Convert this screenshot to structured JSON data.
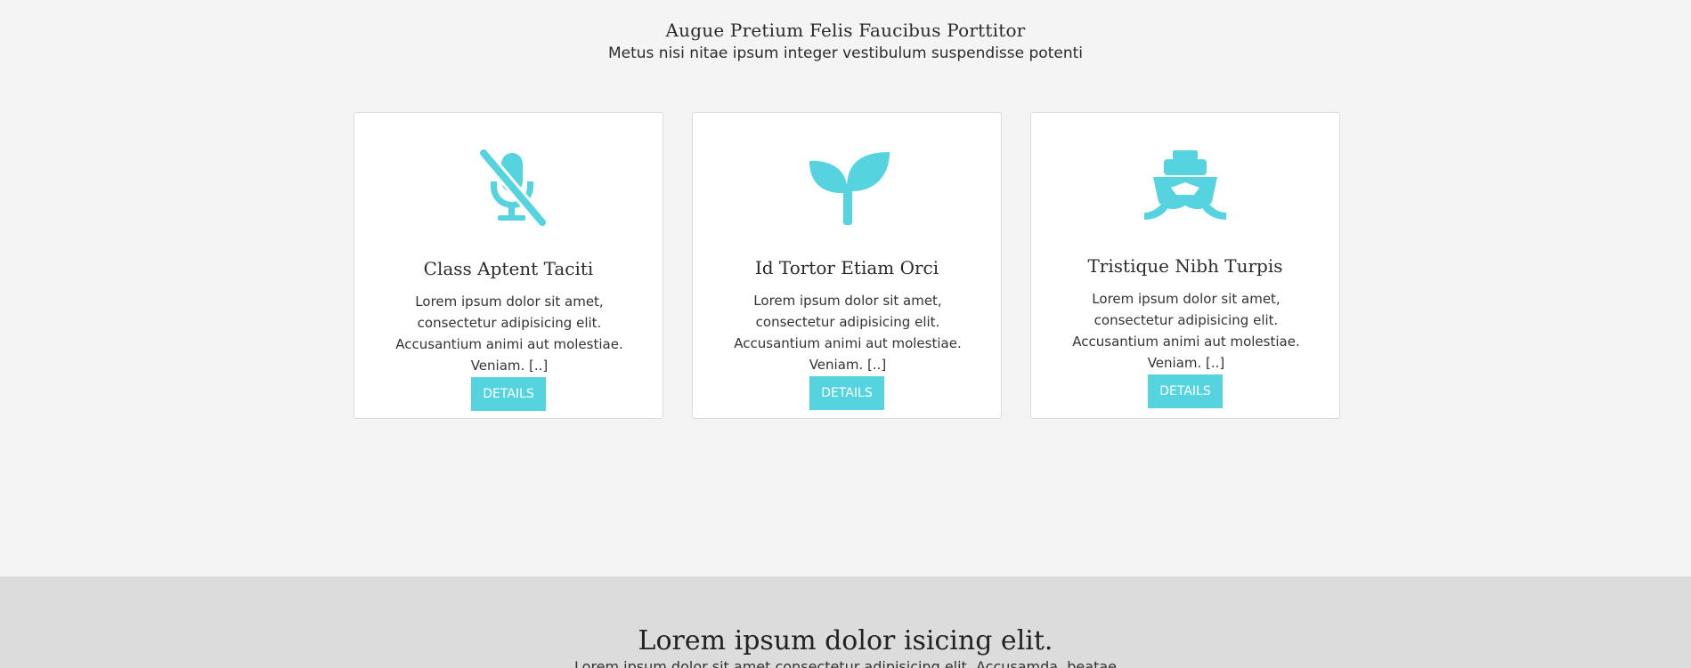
{
  "services": {
    "heading": "Augue Pretium Felis Faucibus Porttitor",
    "subheading": "Metus nisi nitae ipsum integer vestibulum suspendisse potenti",
    "cards": [
      {
        "icon": "microphone-slash-icon",
        "title": "Class Aptent Taciti",
        "text": "Lorem ipsum dolor sit amet, consectetur adipisicing elit. Accusantium animi aut molestiae. Veniam. [..]",
        "button": "DETAILS"
      },
      {
        "icon": "seedling-icon",
        "title": "Id Tortor Etiam Orci",
        "text": "Lorem ipsum dolor sit amet, consectetur adipisicing elit. Accusantium animi aut molestiae. Veniam. [..]",
        "button": "DETAILS"
      },
      {
        "icon": "ship-icon",
        "title": "Tristique Nibh Turpis",
        "text": "Lorem ipsum dolor sit amet, consectetur adipisicing elit. Accusantium animi aut molestiae. Veniam. [..]",
        "button": "DETAILS"
      }
    ]
  },
  "next_section": {
    "heading": "Lorem ipsum dolor isicing elit.",
    "subheading": "Lorem ipsum dolor sit amet consectetur adipisicing elit. Accusamda, beatae"
  },
  "colors": {
    "accent": "#55d4e0",
    "page_background": "#f4f4f4",
    "band_background": "#dcdcdc",
    "card_background": "#ffffff"
  }
}
